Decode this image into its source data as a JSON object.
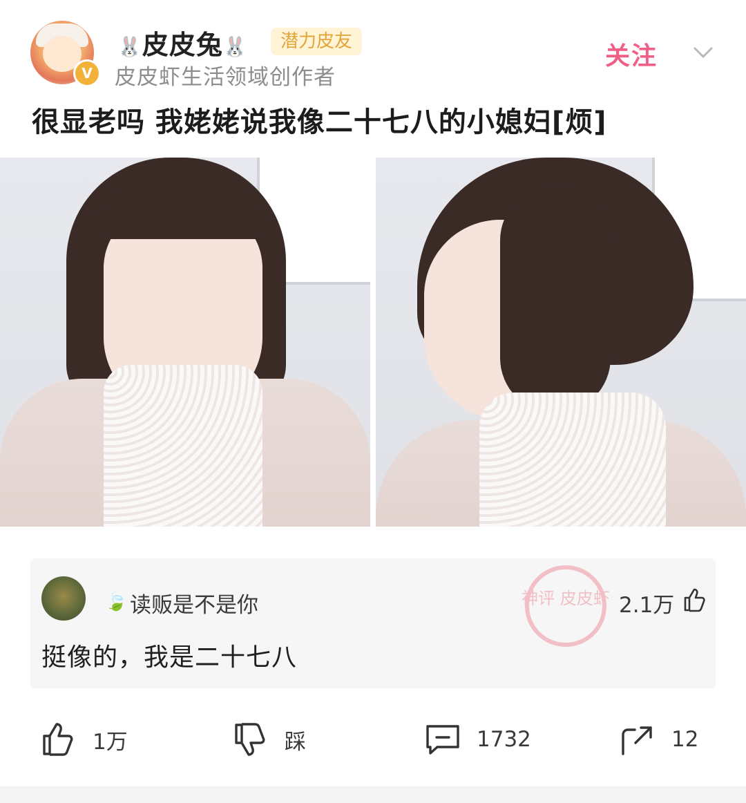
{
  "header": {
    "username": "皮皮兔",
    "username_decor": "🐰",
    "badge": "潜力皮友",
    "subtitle": "皮皮虾生活领域创作者",
    "follow_label": "关注",
    "verified_mark": "V"
  },
  "post": {
    "title": "很显老吗 我姥姥说我像二十七八的小媳妇[烦]"
  },
  "comment": {
    "author": "读贩是不是你",
    "text": "挺像的，我是二十七八",
    "likes": "2.1万",
    "watermark_text": "神评 皮皮虾"
  },
  "actions": {
    "like_count": "1万",
    "dislike_label": "踩",
    "comment_count": "1732",
    "share_count": "12"
  },
  "colors": {
    "follow": "#ef5f86",
    "badge_text": "#e1a53a",
    "badge_bg": "#fff4d6"
  }
}
